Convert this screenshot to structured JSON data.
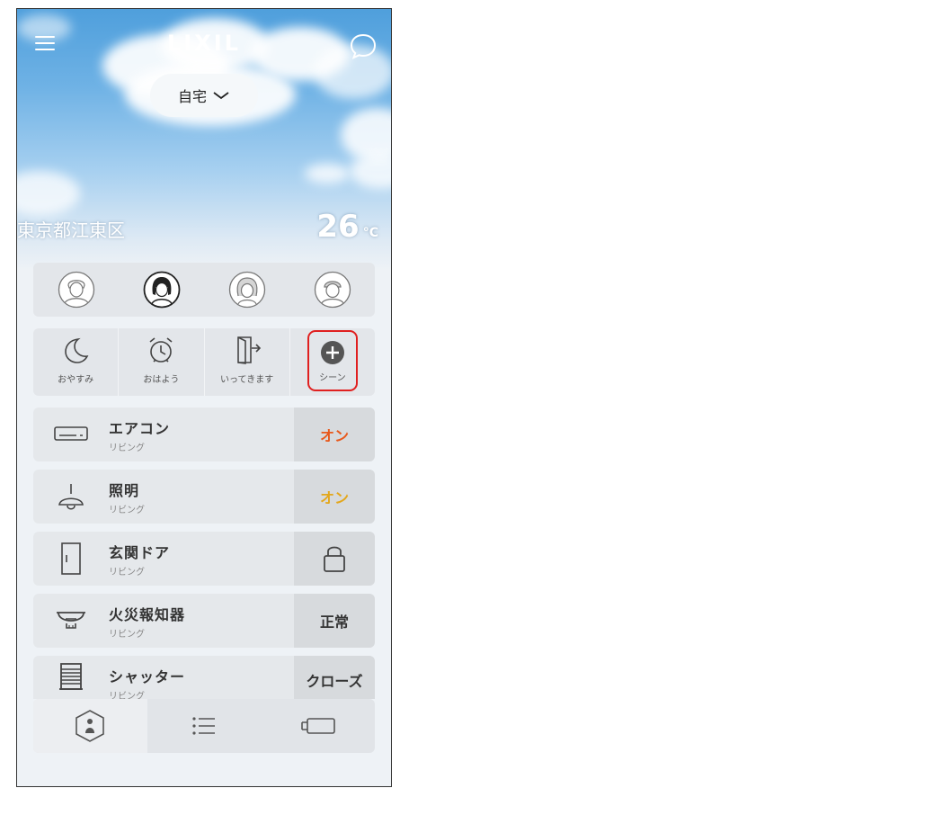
{
  "header": {
    "logo": "LIXIL",
    "home_selector": "自宅",
    "location": "東京都江東区",
    "temperature": "26",
    "temperature_unit": "°C"
  },
  "members": [
    "member-1",
    "member-2",
    "member-3",
    "member-4"
  ],
  "scenes": [
    {
      "label": "おやすみ",
      "icon": "moon-icon"
    },
    {
      "label": "おはよう",
      "icon": "alarm-clock-icon"
    },
    {
      "label": "いってきます",
      "icon": "door-exit-icon"
    },
    {
      "label": "シーン",
      "icon": "plus-circle-icon"
    }
  ],
  "devices": [
    {
      "name": "エアコン",
      "room": "リビング",
      "state": "オン",
      "state_color": "#e8581b",
      "icon": "air-conditioner-icon"
    },
    {
      "name": "照明",
      "room": "リビング",
      "state": "オン",
      "state_color": "#e3a71c",
      "icon": "ceiling-lamp-icon"
    },
    {
      "name": "玄関ドア",
      "room": "リビング",
      "state": "",
      "state_icon": "padlock-icon",
      "icon": "door-icon"
    },
    {
      "name": "火災報知器",
      "room": "リビング",
      "state": "正常",
      "state_color": "#333333",
      "icon": "smoke-detector-icon"
    },
    {
      "name": "シャッター",
      "room": "リビング",
      "state": "クローズ",
      "state_color": "#333333",
      "icon": "shutter-icon"
    }
  ],
  "bottom_nav": [
    {
      "icon": "house-person-icon",
      "active": true
    },
    {
      "icon": "list-icon",
      "active": false
    },
    {
      "icon": "device-icon",
      "active": false
    }
  ]
}
